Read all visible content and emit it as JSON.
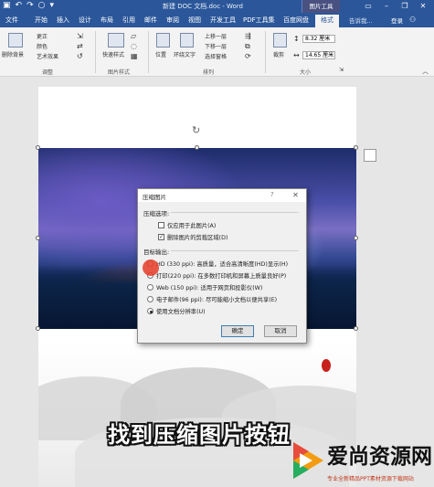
{
  "title_bar": {
    "document_title": "新建 DOC 文档.doc - Word",
    "context_group": "图片工具",
    "qat_icons": [
      "save-icon",
      "undo-icon",
      "redo-icon",
      "touch-mode-icon"
    ]
  },
  "tabs": {
    "items": [
      "文件",
      "开始",
      "插入",
      "设计",
      "布局",
      "引用",
      "邮件",
      "审阅",
      "视图",
      "开发工具",
      "PDF工具集",
      "百度网盘",
      "格式"
    ],
    "active": "格式",
    "search_hint": "告诉我...",
    "login": "登录"
  },
  "ribbon": {
    "remove_bg": "删除背景",
    "corrections": "更正",
    "color": "颜色",
    "artistic": "艺术效果",
    "adjust_label": "调整",
    "quick_styles": "快速样式",
    "picture_styles_label": "图片样式",
    "position": "位置",
    "wrap_text": "环绕文字",
    "bring_forward": "上移一层",
    "send_backward": "下移一层",
    "selection_pane": "选择窗格",
    "arrange_label": "排列",
    "crop": "裁剪",
    "height_value": "8.32 厘米",
    "width_value": "14.65 厘米",
    "size_label": "大小"
  },
  "dialog": {
    "title": "压缩图片",
    "help": "?",
    "close": "✕",
    "compress_options_label": "压缩选项:",
    "opt_only_this": "仅应用于此图片(A)",
    "opt_delete_crop": "删除图片的剪裁区域(D)",
    "target_output_label": "目标输出:",
    "radio_hd": "HD (330 ppi): 高质量，适合高清晰度(HD)显示(H)",
    "radio_print": "打印(220 ppi): 在多数打印机和屏幕上质量良好(P)",
    "radio_web": "Web (150 ppi): 适用于网页和投影仪(W)",
    "radio_email": "电子邮件(96 ppi): 尽可能缩小文档以便共享(E)",
    "radio_doc": "使用文档分辨率(U)",
    "ok": "确定",
    "cancel": "取消",
    "checked": "✓"
  },
  "document": {
    "caption": "找到压缩图片按钮"
  },
  "watermark": {
    "name": "爱尚资源网",
    "sub": "专业全新精品PPT素材资源下载网站"
  },
  "colors": {
    "word_blue": "#2b579a",
    "ribbon_bg": "#f3f3f3",
    "click_marker": "#e63c28"
  }
}
